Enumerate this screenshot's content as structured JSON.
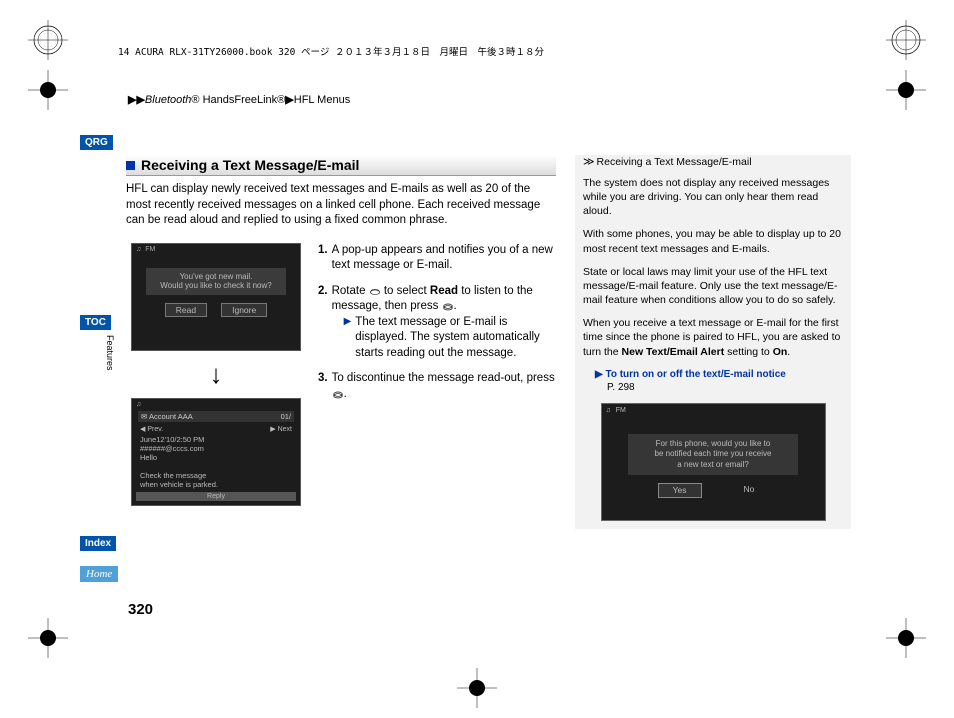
{
  "file_info": "14 ACURA RLX-31TY26000.book  320 ページ  ２０１３年３月１８日　月曜日　午後３時１８分",
  "breadcrumb": {
    "part1": "Bluetooth",
    "reg1": "®",
    "part2": " HandsFreeLink",
    "reg2": "®",
    "part3": "HFL Menus"
  },
  "sidebar": {
    "qrg": "QRG",
    "toc": "TOC",
    "features": "Features",
    "index": "Index",
    "home": "Home"
  },
  "page_number": "320",
  "title": "Receiving a Text Message/E-mail",
  "intro": "HFL can display newly received text messages and E-mails as well as 20 of the most recently received messages on a linked cell phone. Each received message can be read aloud and replied to using a fixed common phrase.",
  "screen1": {
    "fm": "FM",
    "line1": "You've got new mail.",
    "line2": "Would you like to check it now?",
    "btn_read": "Read",
    "btn_ignore": "Ignore"
  },
  "screen2": {
    "account": "Account AAA",
    "count": "01/",
    "prev": "◀ Prev.",
    "next": "▶ Next",
    "date": "June12'10/2:50 PM",
    "sender": "######@cccs.com",
    "greeting": "Hello",
    "msg1": "Check the message",
    "msg2": "when vehicle is parked.",
    "reply": "Reply"
  },
  "steps": {
    "s1_num": "1.",
    "s1": "A pop-up appears and notifies you of a new text message or E-mail.",
    "s2_num": "2.",
    "s2a": "Rotate ",
    "s2b": " to select ",
    "s2_read": "Read",
    "s2c": " to listen to the message, then press ",
    "s2d": ".",
    "s2_sub": "The text message or E-mail is displayed. The system automatically starts reading out the message.",
    "s3_num": "3.",
    "s3a": "To discontinue the message read-out, press ",
    "s3b": "."
  },
  "right": {
    "hdr": "Receiving a Text Message/E-mail",
    "p1": "The system does not display any received messages while you are driving. You can only hear them read aloud.",
    "p2": "With some phones, you may be able to display up to 20 most recent text messages and E-mails.",
    "p3": "State or local laws may limit your use of the HFL text message/E-mail feature. Only use the text message/E-mail feature when conditions allow you to do so safely.",
    "p4a": "When you receive a text message or E-mail for the first time since the phone is paired to HFL, you are asked to turn the ",
    "p4_bold": "New Text/Email Alert",
    "p4b": " setting to ",
    "p4_on": "On",
    "p4c": ".",
    "link": "To turn on or off the text/E-mail notice",
    "link_page": "P. 298",
    "screen3": {
      "fm": "FM",
      "line1": "For this phone, would you like to",
      "line2": "be notified each time you receive",
      "line3": "a new text or email?",
      "yes": "Yes",
      "no": "No"
    }
  }
}
